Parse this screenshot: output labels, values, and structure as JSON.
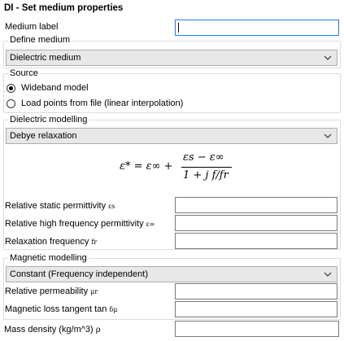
{
  "dialog": {
    "title": "DI - Set medium properties"
  },
  "medium_label": {
    "label": "Medium label",
    "value": ""
  },
  "define_medium": {
    "legend": "Define medium",
    "selected": "Dielectric medium"
  },
  "source": {
    "legend": "Source",
    "options": [
      {
        "label": "Wideband model",
        "checked": true
      },
      {
        "label": "Load points from file (linear interpolation)",
        "checked": false
      }
    ]
  },
  "dielectric_modelling": {
    "legend": "Dielectric modelling",
    "selected": "Debye relaxation",
    "formula": {
      "lhs": "ε* = ε∞ +",
      "numerator": "εs − ε∞",
      "denominator": "1 + j f/fr"
    }
  },
  "dielectric_fields": [
    {
      "label": "Relative static permittivity",
      "symbol": "εs",
      "value": ""
    },
    {
      "label": "Relative high frequency permittivity",
      "symbol": "ε∞",
      "value": ""
    },
    {
      "label": "Relaxation frequency",
      "symbol": "fr",
      "value": ""
    }
  ],
  "magnetic_modelling": {
    "legend": "Magnetic modelling",
    "selected": "Constant (Frequency independent)"
  },
  "magnetic_fields": [
    {
      "label": "Relative permeability",
      "symbol": "μr",
      "value": ""
    },
    {
      "label": "Magnetic loss tangent tan",
      "symbol": "δμ",
      "value": ""
    }
  ],
  "mass_density": {
    "label": "Mass density (kg/m^3)",
    "symbol": "ρ",
    "value": ""
  },
  "icons": {
    "dropdown": "chevron-down-icon",
    "radio_on": "radio-selected-icon",
    "radio_off": "radio-unselected-icon"
  }
}
